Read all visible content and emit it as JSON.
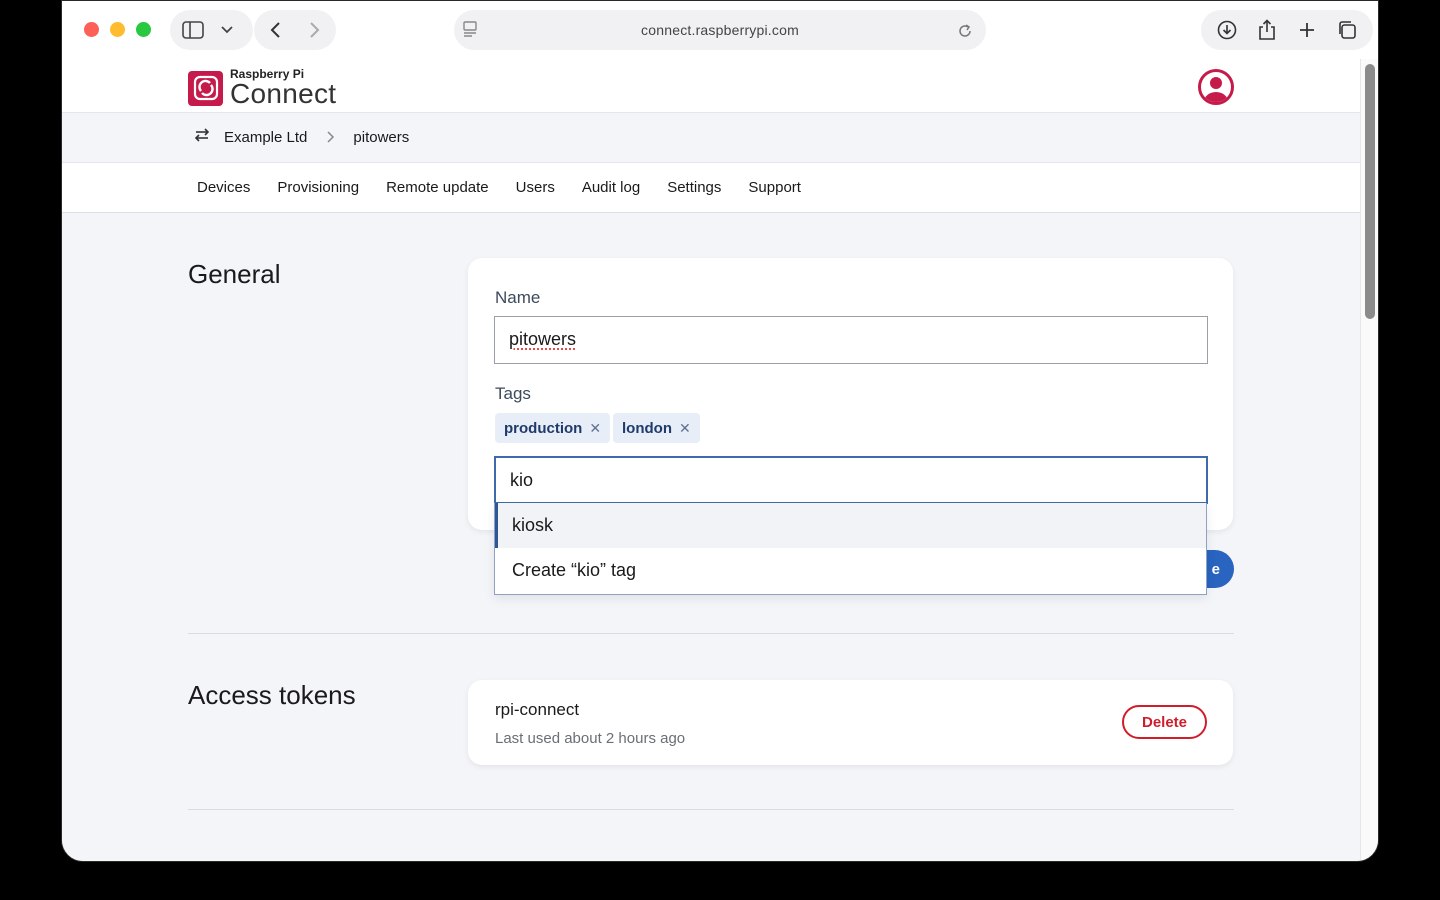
{
  "browser": {
    "url": "connect.raspberrypi.com"
  },
  "app": {
    "brand_small": "Raspberry Pi",
    "brand_large": "Connect",
    "brand_color": "#c51a4a"
  },
  "breadcrumb": {
    "org": "Example Ltd",
    "workspace": "pitowers"
  },
  "tabs": [
    {
      "label": "Devices"
    },
    {
      "label": "Provisioning"
    },
    {
      "label": "Remote update"
    },
    {
      "label": "Users"
    },
    {
      "label": "Audit log"
    },
    {
      "label": "Settings"
    },
    {
      "label": "Support"
    }
  ],
  "general": {
    "title": "General",
    "name_label": "Name",
    "name_value": "pitowers",
    "tags_label": "Tags",
    "tags": [
      {
        "label": "production"
      },
      {
        "label": "london"
      }
    ],
    "tag_input_value": "kio",
    "save_peek": "e",
    "suggestions": [
      {
        "label": "kiosk",
        "active": true
      },
      {
        "label": "Create “kio” tag",
        "active": false
      }
    ]
  },
  "tokens": {
    "title": "Access tokens",
    "items": [
      {
        "name": "rpi-connect",
        "meta": "Last used about 2 hours ago",
        "delete_label": "Delete"
      }
    ]
  }
}
